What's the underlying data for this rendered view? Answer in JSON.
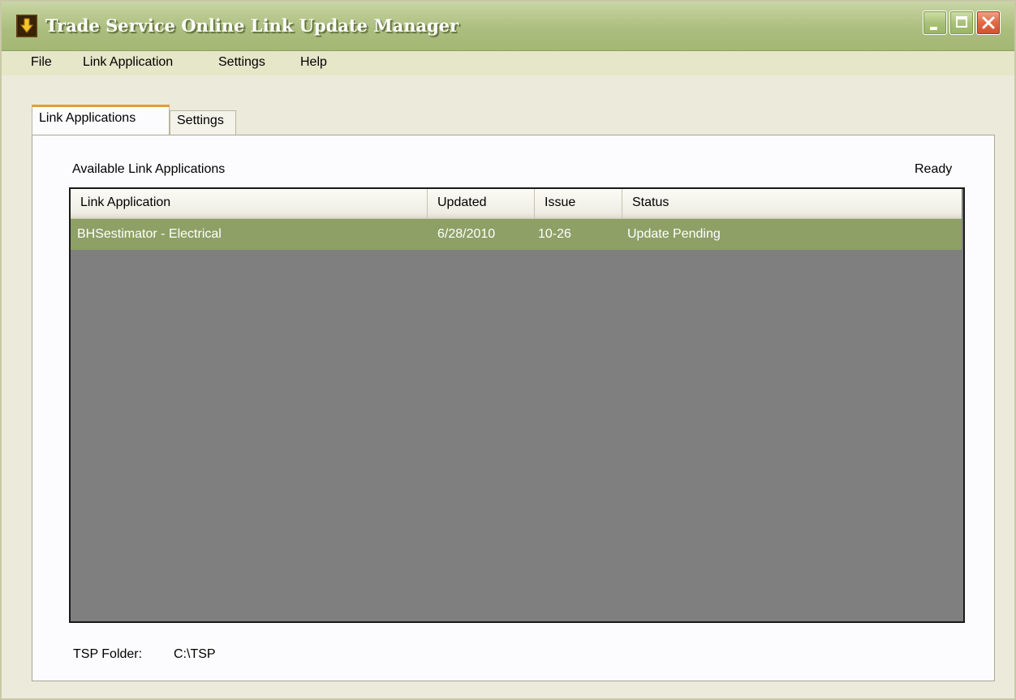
{
  "window": {
    "title": "Trade Service Online Link Update Manager",
    "icon": "app-shield-icon"
  },
  "menubar": {
    "items": [
      "File",
      "Link Application",
      "Settings",
      "Help"
    ]
  },
  "tabs": [
    {
      "label": "Link Applications",
      "active": true
    },
    {
      "label": "Settings",
      "active": false
    }
  ],
  "panel": {
    "list_label": "Available Link Applications",
    "status": "Ready",
    "columns": [
      "Link Application",
      "Updated",
      "Issue",
      "Status"
    ],
    "rows": [
      {
        "link_application": "BHSestimator - Electrical",
        "updated": "6/28/2010",
        "issue": "10-26",
        "status": "Update Pending",
        "selected": true
      }
    ],
    "folder_label": "TSP Folder:",
    "folder_value": "C:\\TSP"
  },
  "colors": {
    "title_bar": "#a3b774",
    "selected_row": "#8ea066",
    "list_background": "#7f7f7f",
    "active_tab_accent": "#e69a3c"
  }
}
